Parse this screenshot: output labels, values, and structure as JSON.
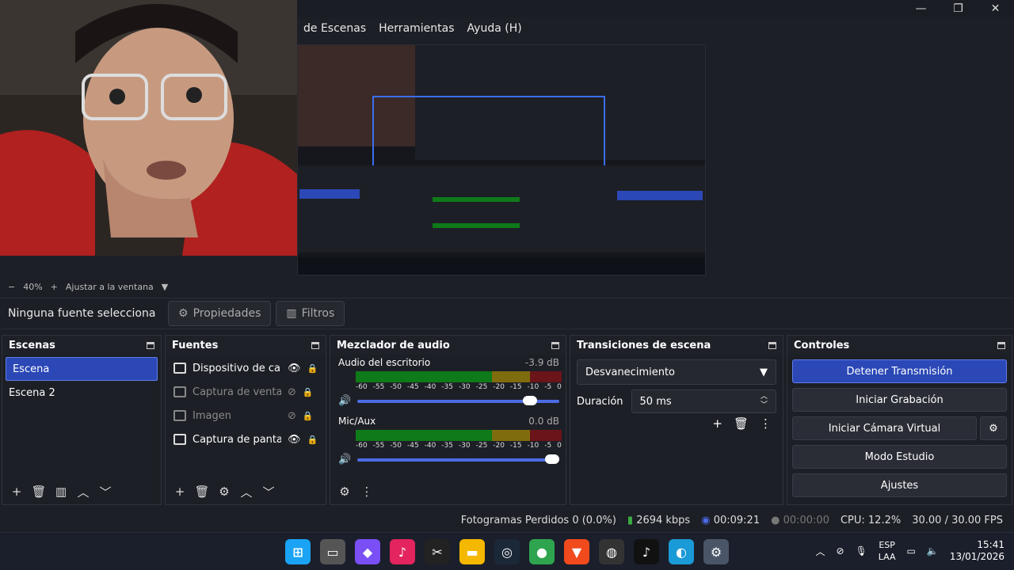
{
  "window": {
    "minimize": "—",
    "maximize": "❐",
    "close": "✕"
  },
  "menu": [
    "de Escenas",
    "Herramientas",
    "Ayuda (H)"
  ],
  "zoom": {
    "minus": "−",
    "value": "40%",
    "plus": "+",
    "fit": "Ajustar a la ventana",
    "arrow": "▼"
  },
  "source_bar": {
    "status": "Ninguna fuente selecciona",
    "props": "Propiedades",
    "filters": "Filtros"
  },
  "scenes": {
    "title": "Escenas",
    "items": [
      "Escena",
      "Escena 2"
    ]
  },
  "sources": {
    "title": "Fuentes",
    "items": [
      {
        "name": "Dispositivo de cap",
        "icon": "camera-icon"
      },
      {
        "name": "Captura de ventan",
        "icon": "window-icon"
      },
      {
        "name": "Imagen",
        "icon": "image-icon"
      },
      {
        "name": "Captura de pantall",
        "icon": "monitor-icon"
      }
    ]
  },
  "mixer": {
    "title": "Mezclador de audio",
    "channels": [
      {
        "name": "Audio del escritorio",
        "db": "-3.9 dB",
        "volume": 0.88
      },
      {
        "name": "Mic/Aux",
        "db": "0.0 dB",
        "volume": 1.0
      }
    ],
    "ticks": [
      "-60",
      "-55",
      "-50",
      "-45",
      "-40",
      "-35",
      "-30",
      "-25",
      "-20",
      "-15",
      "-10",
      "-5",
      "0"
    ]
  },
  "transitions": {
    "title": "Transiciones de escena",
    "selected": "Desvanecimiento",
    "duration_label": "Duración",
    "duration": "50 ms"
  },
  "controls": {
    "title": "Controles",
    "buttons": [
      "Detener Transmisión",
      "Iniciar Grabación",
      "Iniciar Cámara Virtual",
      "Modo Estudio",
      "Ajustes"
    ]
  },
  "status": {
    "dropped": "Fotogramas Perdidos 0 (0.0%)",
    "bitrate": "2694 kbps",
    "stream_time": "00:09:21",
    "rec_time": "00:00:00",
    "cpu": "CPU: 12.2%",
    "fps": "30.00 / 30.00 FPS"
  },
  "tray": {
    "lang1": "ESP",
    "lang2": "LAA",
    "time": "15:41",
    "date": "13/01/2026"
  },
  "colors": {
    "accent": "#2b48b6",
    "meter_green": "#0f7a19",
    "meter_yellow": "#7f6d0d",
    "meter_red": "#6b1419"
  }
}
